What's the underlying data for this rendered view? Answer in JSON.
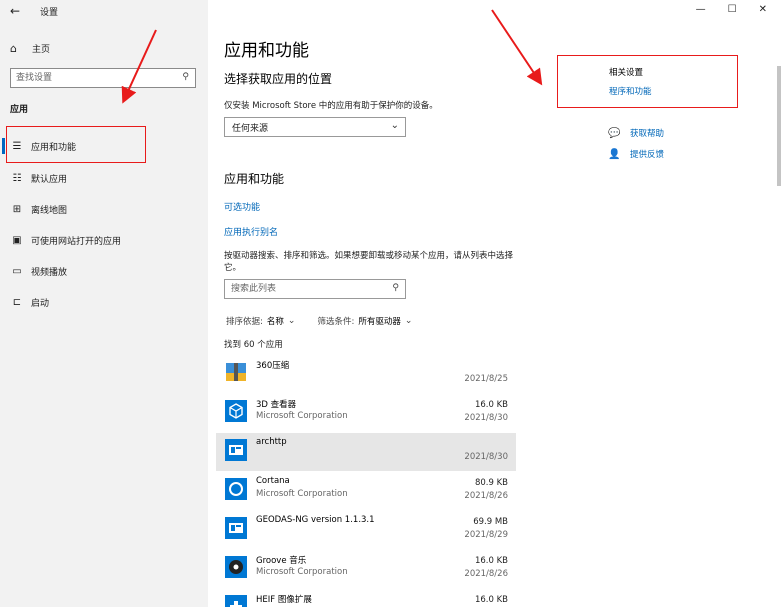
{
  "window": {
    "title": "设置"
  },
  "sidebar": {
    "home_label": "主页",
    "search_placeholder": "查找设置",
    "section_label": "应用",
    "items": [
      {
        "label": "应用和功能",
        "icon": "list-icon",
        "active": true
      },
      {
        "label": "默认应用",
        "icon": "default-apps-icon"
      },
      {
        "label": "离线地图",
        "icon": "map-icon"
      },
      {
        "label": "可使用网站打开的应用",
        "icon": "web-app-icon"
      },
      {
        "label": "视频播放",
        "icon": "video-icon"
      },
      {
        "label": "启动",
        "icon": "startup-icon"
      }
    ]
  },
  "main": {
    "title": "应用和功能",
    "install_section": {
      "title": "选择获取应用的位置",
      "description": "仅安装 Microsoft Store 中的应用有助于保护你的设备。",
      "dropdown_value": "任何来源"
    },
    "apps_section": {
      "title": "应用和功能",
      "link_optional": "可选功能",
      "link_alias": "应用执行别名",
      "description": "按驱动器搜索、排序和筛选。如果想要卸载或移动某个应用，请从列表中选择它。",
      "search_placeholder": "搜索此列表",
      "sort_label": "排序依据:",
      "sort_value": "名称",
      "filter_label": "筛选条件:",
      "filter_value": "所有驱动器",
      "found_count": "找到 60 个应用"
    },
    "apps": [
      {
        "name": "360压缩",
        "publisher": "",
        "size": "",
        "date": "2021/8/25"
      },
      {
        "name": "3D 查看器",
        "publisher": "Microsoft Corporation",
        "size": "16.0 KB",
        "date": "2021/8/30"
      },
      {
        "name": "archttp",
        "publisher": "",
        "size": "",
        "date": "2021/8/30",
        "selected": true
      },
      {
        "name": "Cortana",
        "publisher": "Microsoft Corporation",
        "size": "80.9 KB",
        "date": "2021/8/26"
      },
      {
        "name": "GEODAS-NG version 1.1.3.1",
        "publisher": "",
        "size": "69.9 MB",
        "date": "2021/8/29"
      },
      {
        "name": "Groove 音乐",
        "publisher": "Microsoft Corporation",
        "size": "16.0 KB",
        "date": "2021/8/26"
      },
      {
        "name": "HEIF 图像扩展",
        "publisher": "",
        "size": "16.0 KB",
        "date": ""
      }
    ]
  },
  "related": {
    "title": "相关设置",
    "link": "程序和功能",
    "help": "获取帮助",
    "feedback": "提供反馈"
  },
  "colors": {
    "accent": "#0067c0",
    "link": "#0067b8",
    "annotation": "#e81b1b"
  }
}
